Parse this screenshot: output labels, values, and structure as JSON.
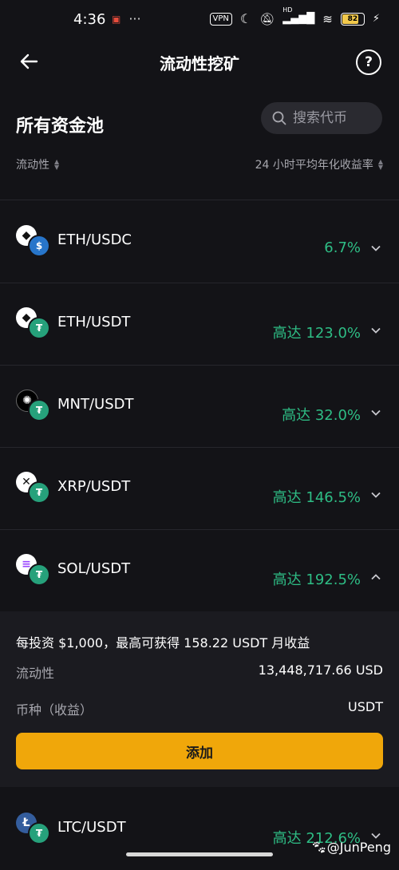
{
  "status_bar": {
    "time": "4:36",
    "left_icons": [
      "notification-icon",
      "more-dots-icon"
    ],
    "dots": "···",
    "vpn": "VPN",
    "hd": "HD",
    "battery_level": "82"
  },
  "header": {
    "title": "流动性挖矿"
  },
  "section": {
    "title": "所有资金池",
    "search_placeholder": "搜索代币"
  },
  "sort": {
    "left_label": "流动性",
    "right_label": "24 小时平均年化收益率"
  },
  "colors": {
    "background": "#131317",
    "green": "#2ebd85",
    "accent": "#f0a70a"
  },
  "pools": [
    {
      "name": "ETH/USDC",
      "apr": "6.7%",
      "main_coin": "ETH",
      "sub_coin": "USDC",
      "expanded": false
    },
    {
      "name": "ETH/USDT",
      "apr": "高达 123.0%",
      "main_coin": "ETH",
      "sub_coin": "USDT",
      "expanded": false
    },
    {
      "name": "MNT/USDT",
      "apr": "高达 32.0%",
      "main_coin": "MNT",
      "sub_coin": "USDT",
      "expanded": false
    },
    {
      "name": "XRP/USDT",
      "apr": "高达 146.5%",
      "main_coin": "XRP",
      "sub_coin": "USDT",
      "expanded": false
    },
    {
      "name": "SOL/USDT",
      "apr": "高达 192.5%",
      "main_coin": "SOL",
      "sub_coin": "USDT",
      "expanded": true
    },
    {
      "name": "LTC/USDT",
      "apr": "高达 212.6%",
      "main_coin": "LTC",
      "sub_coin": "USDT",
      "expanded": false
    }
  ],
  "expanded_detail": {
    "headline": "每投资 $1,000，最高可获得 158.22 USDT 月收益",
    "liquidity_label": "流动性",
    "liquidity_value": "13,448,717.66 USD",
    "coin_label": "币种（收益）",
    "coin_value": "USDT",
    "add_button": "添加"
  },
  "watermark": "@JunPeng"
}
